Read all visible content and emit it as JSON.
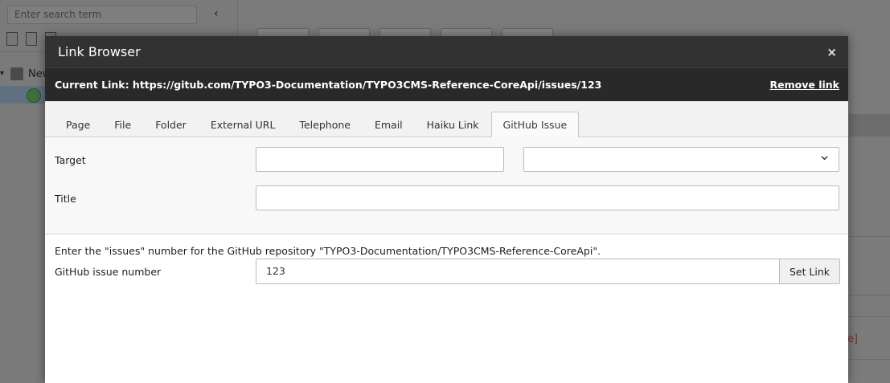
{
  "background": {
    "search_placeholder": "Enter search term",
    "collapse_glyph": "‹",
    "tree_root_label": "New"
  },
  "modal": {
    "title": "Link Browser",
    "close_glyph": "×",
    "current_link": "Current Link: https://gitub.com/TYPO3-Documentation/TYPO3CMS-Reference-CoreApi/issues/123",
    "remove_link": "Remove link",
    "tabs": [
      {
        "label": "Page",
        "active": false
      },
      {
        "label": "File",
        "active": false
      },
      {
        "label": "Folder",
        "active": false
      },
      {
        "label": "External URL",
        "active": false
      },
      {
        "label": "Telephone",
        "active": false
      },
      {
        "label": "Email",
        "active": false
      },
      {
        "label": "Haiku Link",
        "active": false
      },
      {
        "label": "GitHub Issue",
        "active": true
      }
    ],
    "form": {
      "target_label": "Target",
      "target_value": "",
      "target_select_value": "",
      "title_label": "Title",
      "title_value": ""
    },
    "github": {
      "help_text": "Enter the \"issues\" number for the GitHub repository \"TYPO3-Documentation/TYPO3CMS-Reference-CoreApi\".",
      "issue_label": "GitHub issue number",
      "issue_value": "123",
      "set_link_label": "Set Link"
    }
  },
  "colors": {
    "header_bg": "#323232",
    "subheader_bg": "#292929",
    "overlay": "#7b7b7b"
  }
}
